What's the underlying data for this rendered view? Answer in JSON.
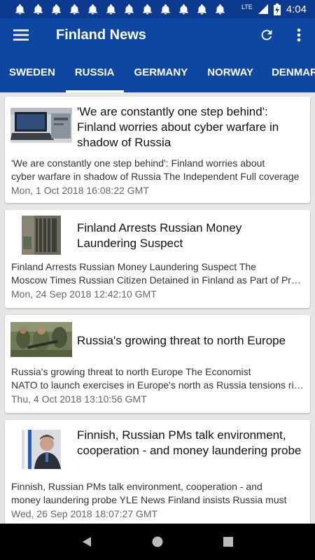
{
  "status_bar": {
    "network": "LTE",
    "time": "4:04",
    "notification_count": 12
  },
  "app_bar": {
    "title": "Finland News"
  },
  "tabs": [
    {
      "label": "SWEDEN",
      "active": false
    },
    {
      "label": "RUSSIA",
      "active": true
    },
    {
      "label": "GERMANY",
      "active": false
    },
    {
      "label": "NORWAY",
      "active": false
    },
    {
      "label": "DENMARK",
      "active": false
    }
  ],
  "articles": [
    {
      "headline": "'We are constantly one step behind': Finland worries about cyber warfare in shadow of Russia",
      "desc_line1": "'We are constantly one step behind': Finland worries about",
      "desc_line2": "cyber warfare in shadow of Russia  The Independent  Full coverage",
      "date": "Mon, 1 Oct 2018 16:08:22 GMT"
    },
    {
      "headline": "Finland Arrests Russian Money Laundering Suspect",
      "desc_line1": "Finland Arrests Russian Money Laundering Suspect  The",
      "desc_line2": "Moscow Times  Russian Citizen Detained in Finland as Part of Probe",
      "date": "Mon, 24 Sep 2018 12:42:10 GMT"
    },
    {
      "headline": "Russia's growing threat to north Europe",
      "desc_line1": "Russia's growing threat to north Europe  The Economist",
      "desc_line2": "NATO to launch exercises in Europe's north as Russia tensions rise",
      "date": "Thu, 4 Oct 2018 13:10:56 GMT"
    },
    {
      "headline": "Finnish, Russian PMs talk environment, cooperation - and money laundering probe",
      "desc_line1": "Finnish, Russian PMs talk environment, cooperation - and",
      "desc_line2": "money laundering probe  YLE News  Finland insists Russia must",
      "date": "Wed, 26 Sep 2018 18:07:27 GMT"
    }
  ],
  "colors": {
    "primary": "#0d47a1",
    "status_bar": "#0b3a8e",
    "background": "#e6e6e6"
  },
  "icons": [
    "notification-bell-icon",
    "menu-icon",
    "refresh-icon",
    "overflow-menu-icon",
    "battery-charging-icon",
    "signal-icon",
    "back-icon",
    "home-icon",
    "recents-icon"
  ]
}
